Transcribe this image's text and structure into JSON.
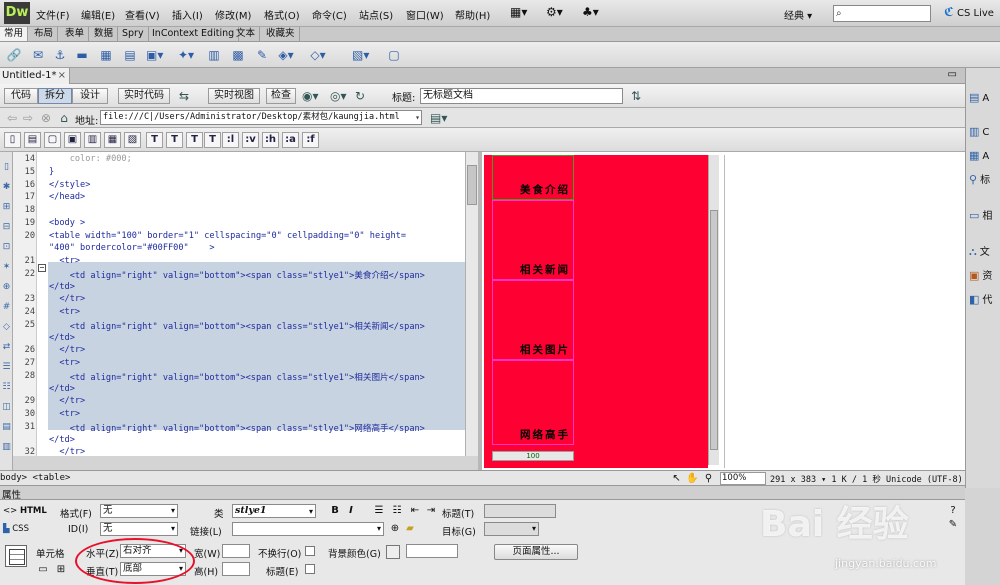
{
  "app": {
    "logo": "Dw",
    "menu": [
      "文件(F)",
      "编辑(E)",
      "查看(V)",
      "插入(I)",
      "修改(M)",
      "格式(O)",
      "命令(C)",
      "站点(S)",
      "窗口(W)",
      "帮助(H)"
    ],
    "workspace": "经典",
    "search_placeholder": "",
    "cslive": "CS Live"
  },
  "insert_tabs": [
    "常用",
    "布局",
    "表单",
    "数据",
    "Spry",
    "InContext Editing",
    "文本",
    "收藏夹"
  ],
  "document": {
    "tab_name": "Untitled-1*",
    "views": {
      "code": "代码",
      "split": "拆分",
      "design": "设计",
      "live_code": "实时代码",
      "live_view": "实时视图",
      "inspect": "检查"
    },
    "title_label": "标题:",
    "title_value": "无标题文档",
    "address_label": "地址:",
    "address_value": "file:///C|/Users/Administrator/Desktop/素材包/kaungjia.html",
    "css_buttons": [
      ":l",
      ":v",
      ":h",
      ":a",
      ":f"
    ]
  },
  "code": {
    "lines": [
      {
        "n": "14",
        "text": "    color: #000;",
        "sel": false
      },
      {
        "n": "15",
        "text": "}",
        "sel": false
      },
      {
        "n": "16",
        "text": "</style>",
        "sel": false
      },
      {
        "n": "17",
        "text": "</head>",
        "sel": false
      },
      {
        "n": "18",
        "text": "",
        "sel": false
      },
      {
        "n": "19",
        "text": "<body >",
        "sel": false
      },
      {
        "n": "20",
        "text": "<table width=\"100\" border=\"1\" cellspacing=\"0\" cellpadding=\"0\" height=",
        "sel": false
      },
      {
        "n": "",
        "text": "\"400\" bordercolor=\"#00FF00\"    >",
        "sel": false
      },
      {
        "n": "21",
        "text": "  <tr>",
        "sel": false
      },
      {
        "n": "22",
        "text": "    <td align=\"right\" valign=\"bottom\"><span class=\"stlye1\">美食介绍</span>",
        "sel": true
      },
      {
        "n": "",
        "text": "</td>",
        "sel": true
      },
      {
        "n": "23",
        "text": "  </tr>",
        "sel": true
      },
      {
        "n": "24",
        "text": "  <tr>",
        "sel": true
      },
      {
        "n": "25",
        "text": "    <td align=\"right\" valign=\"bottom\"><span class=\"stlye1\">相关新闻</span>",
        "sel": true
      },
      {
        "n": "",
        "text": "</td>",
        "sel": true
      },
      {
        "n": "26",
        "text": "  </tr>",
        "sel": true
      },
      {
        "n": "27",
        "text": "  <tr>",
        "sel": true
      },
      {
        "n": "28",
        "text": "    <td align=\"right\" valign=\"bottom\"><span class=\"stlye1\">相关图片</span>",
        "sel": true
      },
      {
        "n": "",
        "text": "</td>",
        "sel": true
      },
      {
        "n": "29",
        "text": "  </tr>",
        "sel": true
      },
      {
        "n": "30",
        "text": "  <tr>",
        "sel": true
      },
      {
        "n": "31",
        "text": "    <td align=\"right\" valign=\"bottom\"><span class=\"stlye1\">网络高手</span>",
        "sel": true
      },
      {
        "n": "",
        "text": "</td>",
        "sel": false
      },
      {
        "n": "32",
        "text": "  </tr>",
        "sel": false
      }
    ]
  },
  "design": {
    "cells": [
      "美食介绍",
      "相关新闻",
      "相关图片",
      "网络高手"
    ],
    "width_label": "100",
    "bg_color": "#ff0033",
    "border_color": "#ff33cc"
  },
  "right_panel": [
    "A",
    "C",
    "A",
    "标",
    "相",
    "文",
    "资",
    "代"
  ],
  "status": {
    "tag_selector": "body> <table>",
    "zoom": "100%",
    "info": "291 x 383 ▾  1 K / 1 秒  Unicode (UTF-8)"
  },
  "properties": {
    "header": "属性",
    "html_tab": "HTML",
    "css_tab": "CSS",
    "format_label": "格式(F)",
    "format_value": "无",
    "class_label": "类",
    "class_value": "stlye1",
    "bold": "B",
    "italic": "I",
    "title_label": "标题(T)",
    "id_label": "ID(I)",
    "id_value": "无",
    "link_label": "链接(L)",
    "target_label": "目标(G)",
    "cell_label": "单元格",
    "horz_label": "水平(Z)",
    "horz_value": "右对齐",
    "width_label": "宽(W)",
    "nowrap_label": "不换行(O)",
    "bgcolor_label": "背景颜色(G)",
    "page_props": "页面属性...",
    "vert_label": "垂直(T)",
    "vert_value": "底部",
    "height_label": "高(H)",
    "header_label": "标题(E)"
  },
  "watermark": {
    "text": "Bai 经验",
    "url": "jingyan.baidu.com"
  }
}
